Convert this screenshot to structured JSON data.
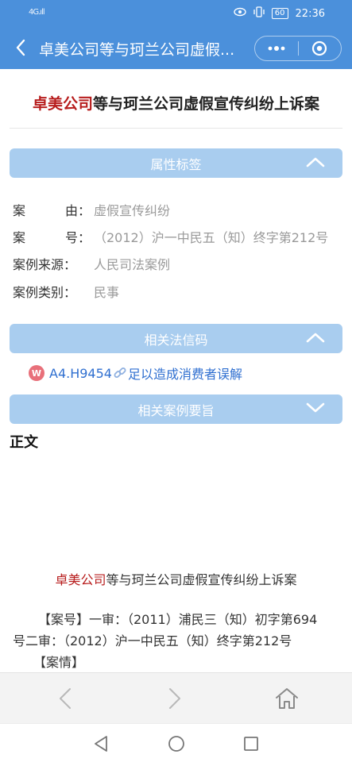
{
  "status_bar": {
    "signal": "4G.ıll",
    "battery": "60",
    "time": "22:36"
  },
  "nav": {
    "title": "卓美公司等与珂兰公司虚假..."
  },
  "case_title": {
    "highlight": "卓美公司",
    "rest": "等与珂兰公司虚假宣传纠纷上诉案"
  },
  "sections": {
    "attributes": "属性标签",
    "laws": "相关法信码",
    "summary": "相关案例要旨"
  },
  "attributes": [
    {
      "label_a": "案",
      "label_b": "由：",
      "value": "虚假宣传纠纷"
    },
    {
      "label_a": "案",
      "label_b": "号：",
      "value": "（2012）沪一中民五（知）终字第212号"
    },
    {
      "label_a": "案例来源",
      "label_b": "：",
      "value": "人民司法案例"
    },
    {
      "label_a": "案例类别",
      "label_b": "：",
      "value": "民事"
    }
  ],
  "law_link": {
    "badge": "W",
    "code": "A4.H9454",
    "text": "足以造成消费者误解"
  },
  "body": {
    "heading": "正文",
    "title_highlight": "卓美公司",
    "title_rest": "等与珂兰公司虚假宣传纠纷上诉案",
    "case_no_line1": "【案号】一审：（2011）浦民三（知）初字第694",
    "case_no_line2": "号二审：（2012）沪一中民五（知）终字第212号",
    "case_facts": "【案情】"
  },
  "icons": {
    "back": "back-arrow-icon",
    "more": "more-dots-icon",
    "close": "close-circle-icon",
    "prev": "prev-page-icon",
    "next": "next-page-icon",
    "home": "home-icon"
  },
  "colors": {
    "primary": "#4b90db",
    "section": "#a9cdef",
    "highlight": "#b71c1c",
    "link": "#2f6fd0"
  }
}
